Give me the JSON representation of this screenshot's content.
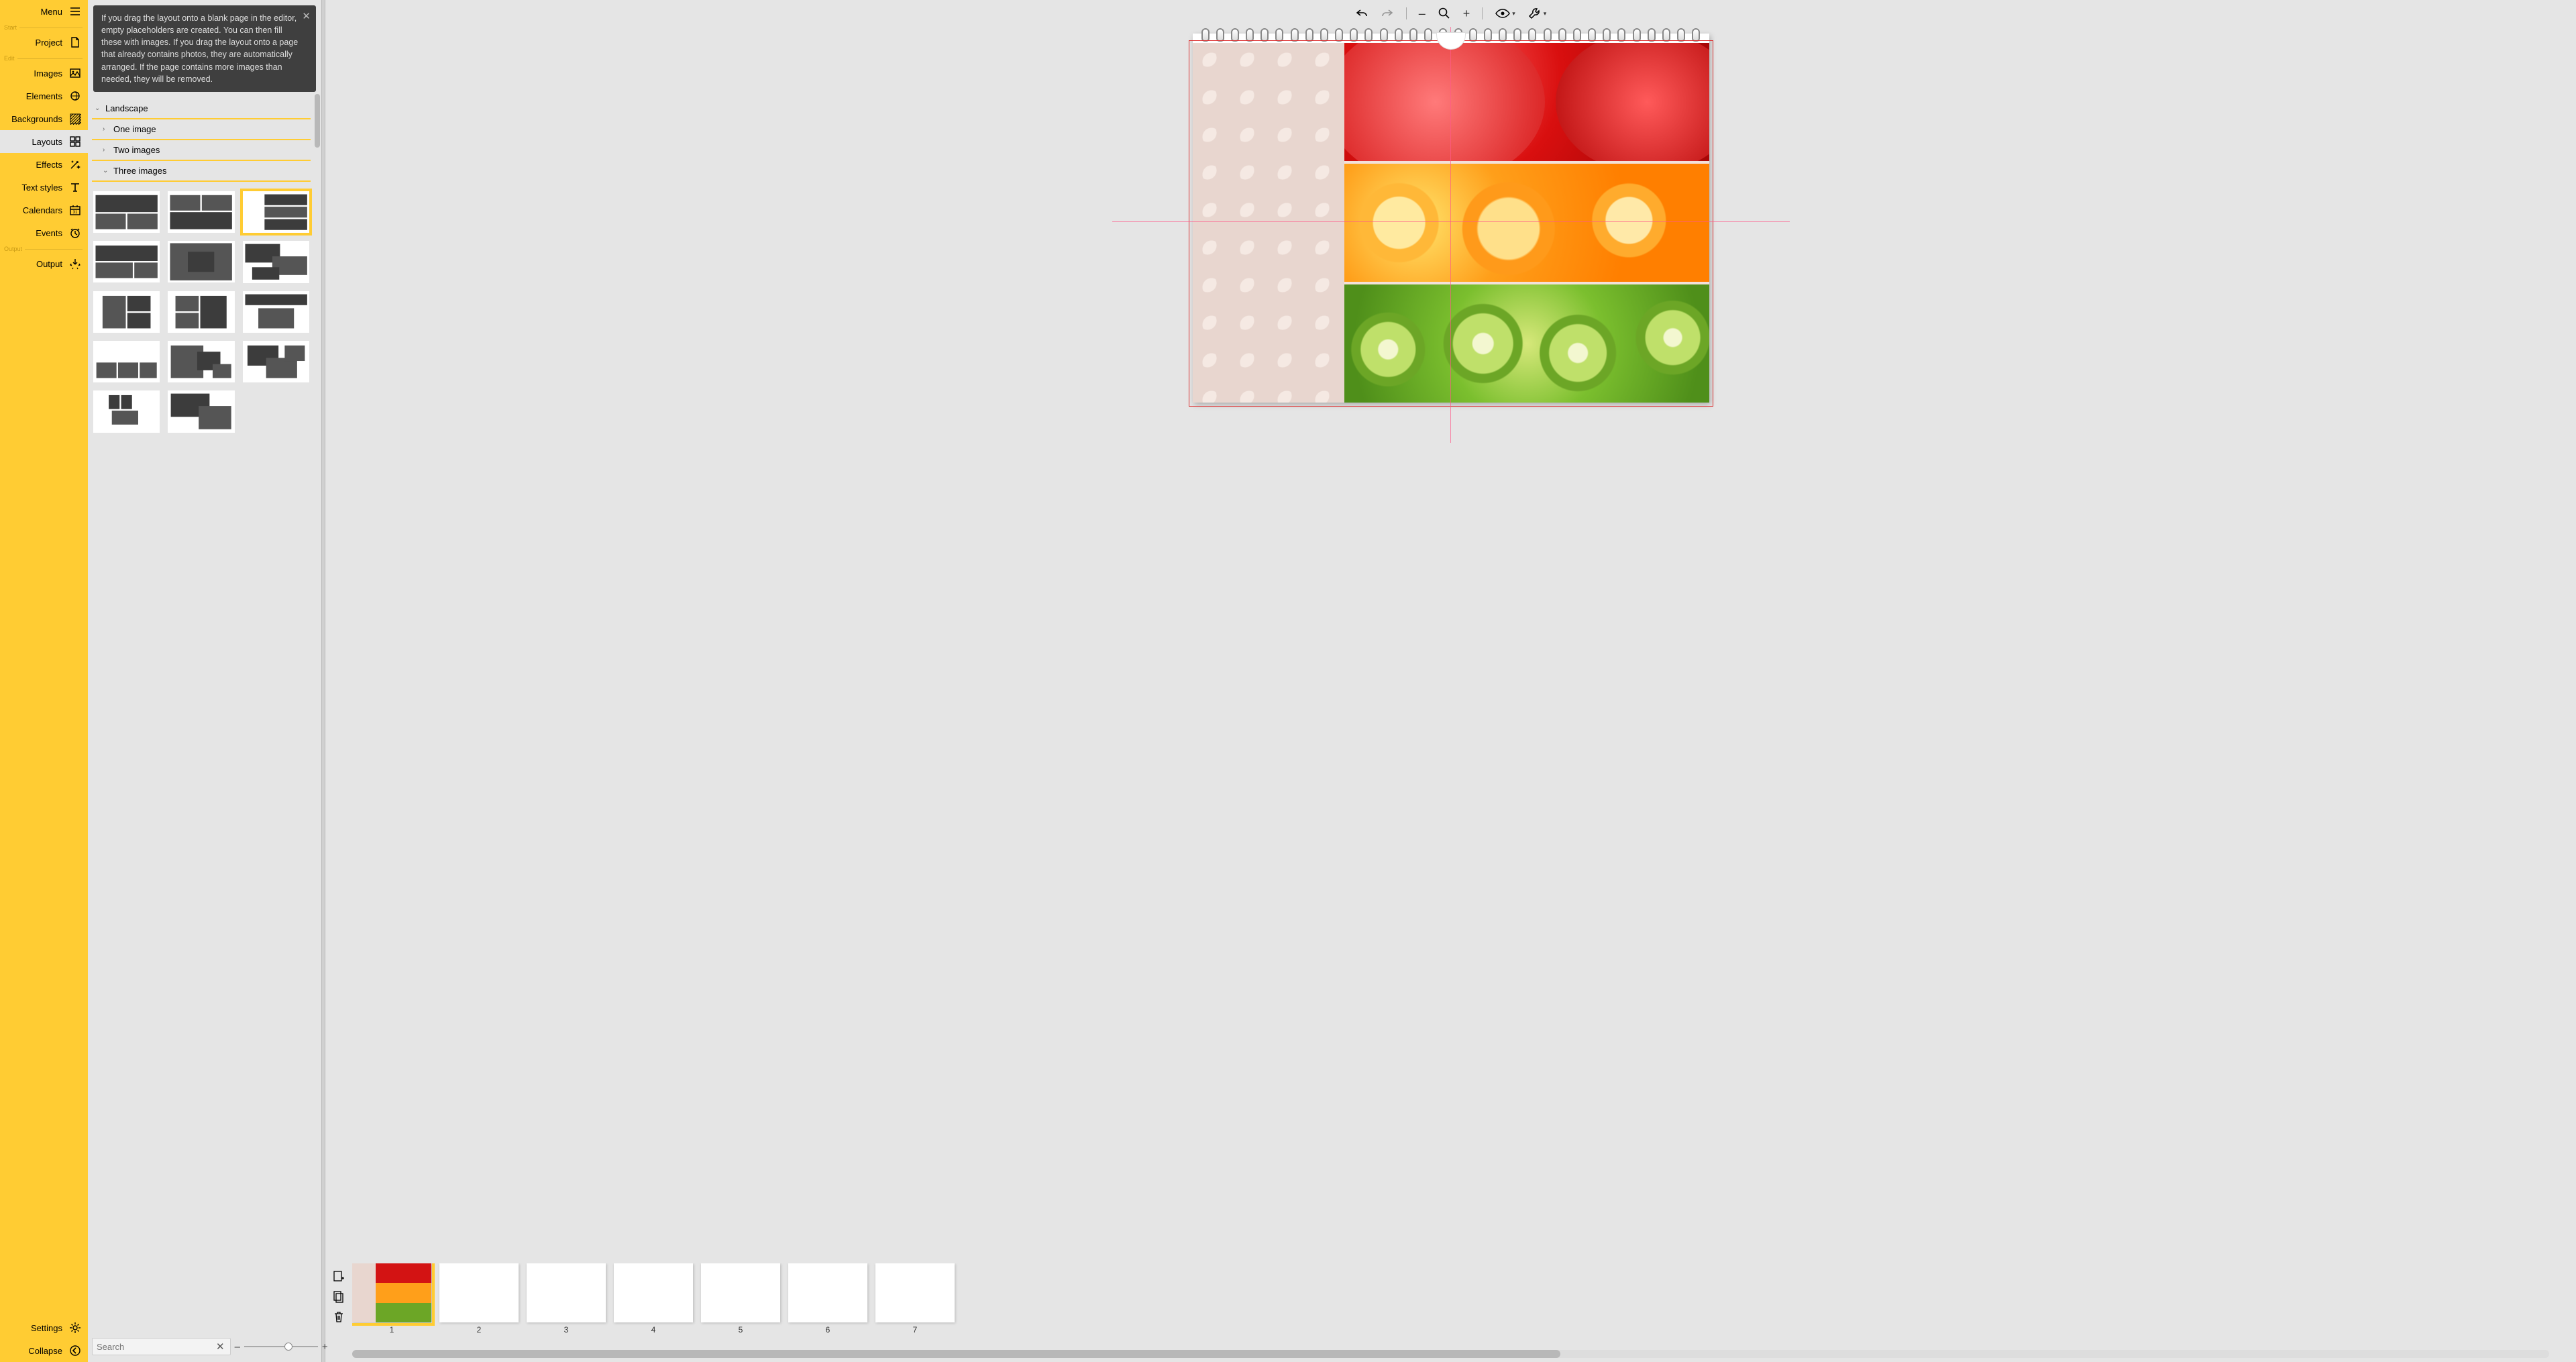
{
  "sidebar": {
    "menu": "Menu",
    "sections": {
      "start": "Start",
      "edit": "Edit",
      "output": "Output"
    },
    "items": {
      "project": "Project",
      "images": "Images",
      "elements": "Elements",
      "backgrounds": "Backgrounds",
      "layouts": "Layouts",
      "effects": "Effects",
      "text_styles": "Text styles",
      "calendars": "Calendars",
      "events": "Events",
      "output_item": "Output",
      "settings": "Settings",
      "collapse": "Collapse"
    },
    "active": "layouts"
  },
  "panel": {
    "tooltip": "If you drag the layout onto a blank page in the editor, empty placeholders are created. You can then fill these with images. If you drag the layout onto a page that already contains photos, they are automatically arranged. If the page contains more images than needed, they will be removed.",
    "accordion": {
      "landscape": "Landscape",
      "one": "One image",
      "two": "Two images",
      "three": "Three images"
    },
    "search_placeholder": "Search",
    "zoom": {
      "minus": "–",
      "plus": "+"
    },
    "selected_layout_index": 2
  },
  "filmstrip": {
    "pages": [
      "1",
      "2",
      "3",
      "4",
      "5",
      "6",
      "7"
    ],
    "selected": 0
  }
}
